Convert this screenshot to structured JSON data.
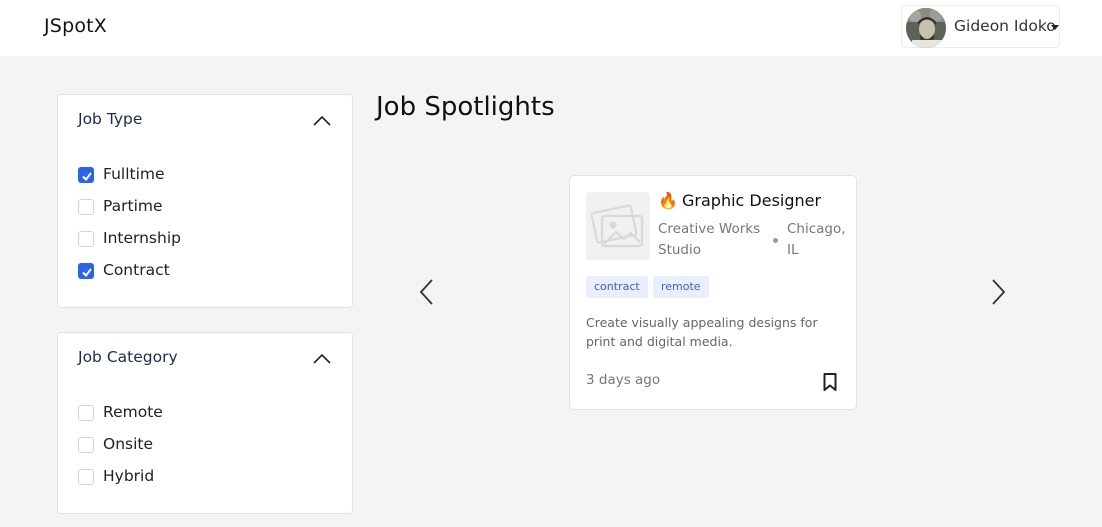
{
  "navbar": {
    "brand": "JSpotX",
    "user": {
      "name": "Gideon Idoko",
      "avatar_icon": "user-avatar-photo"
    }
  },
  "filters": {
    "job_type": {
      "title": "Job Type",
      "expanded": true,
      "options": [
        {
          "label": "Fulltime",
          "checked": true
        },
        {
          "label": "Partime",
          "checked": false
        },
        {
          "label": "Internship",
          "checked": false
        },
        {
          "label": "Contract",
          "checked": true
        }
      ]
    },
    "job_category": {
      "title": "Job Category",
      "expanded": true,
      "options": [
        {
          "label": "Remote",
          "checked": false
        },
        {
          "label": "Onsite",
          "checked": false
        },
        {
          "label": "Hybrid",
          "checked": false
        }
      ]
    }
  },
  "spotlight": {
    "title": "Job Spotlights",
    "prev_icon": "chevron-left-icon",
    "next_icon": "chevron-right-icon",
    "job": {
      "emoji": "🔥",
      "title": "Graphic Designer",
      "company": "Creative Works Studio",
      "location": "Chicago, IL",
      "tags": [
        "contract",
        "remote"
      ],
      "description": "Create visually appealing designs for print and digital media.",
      "posted": "3 days ago",
      "bookmark_icon": "bookmark-icon",
      "logo_icon": "image-placeholder-icon"
    }
  },
  "colors": {
    "accent": "#2c62e8",
    "page_bg": "#f4f4f5",
    "heading": "#1e2a55",
    "tag_bg": "#e8eefb",
    "tag_text": "#3a63c8"
  }
}
